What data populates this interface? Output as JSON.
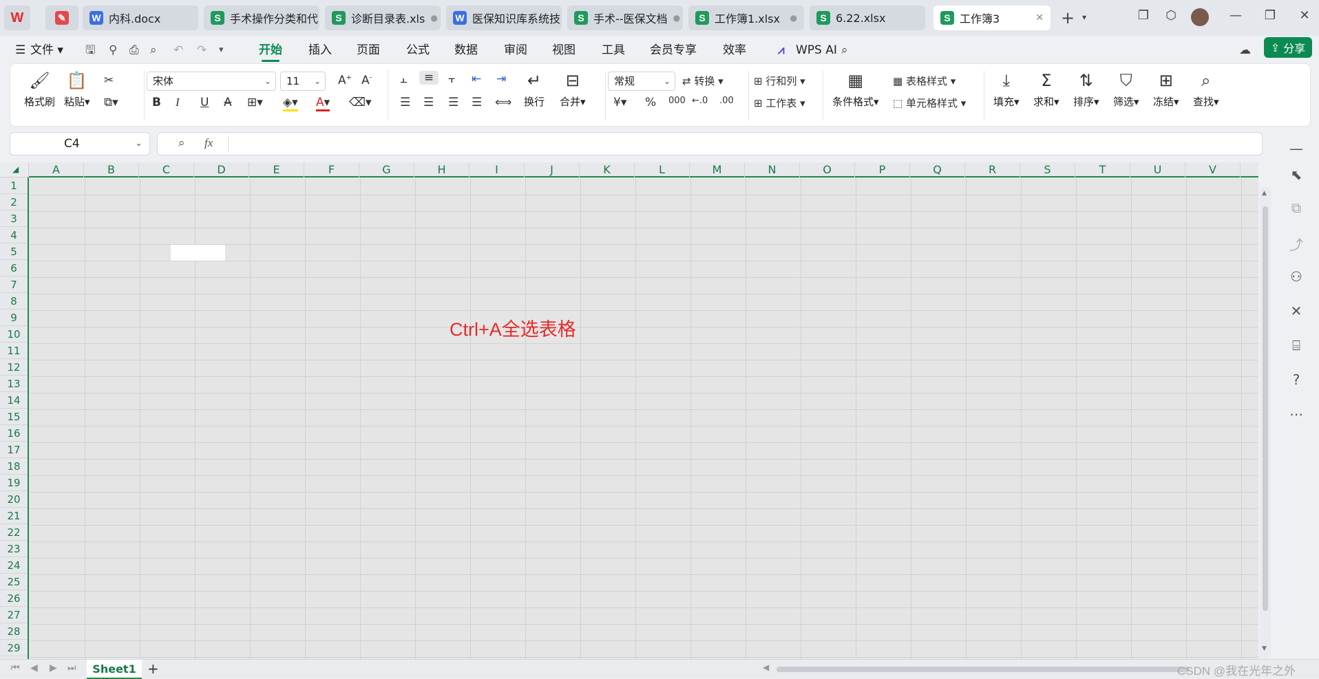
{
  "tabs": [
    {
      "label": "",
      "icon": "wps-logo-icon"
    },
    {
      "label": "",
      "icon": "pdf-icon"
    },
    {
      "label": "内科.docx",
      "type": "W"
    },
    {
      "label": "手术操作分类和代",
      "type": "S"
    },
    {
      "label": "诊断目录表.xls",
      "type": "S",
      "dot": "●"
    },
    {
      "label": "医保知识库系统技",
      "type": "W"
    },
    {
      "label": "手术--医保文档",
      "type": "S",
      "dot": "●"
    },
    {
      "label": "工作簿1.xlsx",
      "type": "S",
      "dot": "●"
    },
    {
      "label": "6.22.xlsx",
      "type": "S"
    },
    {
      "label": "工作簿3",
      "type": "S",
      "active": true,
      "close": "✕"
    }
  ],
  "menu": {
    "file": "文件",
    "items": [
      "开始",
      "插入",
      "页面",
      "公式",
      "数据",
      "审阅",
      "视图",
      "工具",
      "会员专享",
      "效率"
    ],
    "active": "开始",
    "wps_ai": "WPS AI",
    "share": "分享"
  },
  "ribbon": {
    "format_painter": "格式刷",
    "paste": "粘贴",
    "font_name": "宋体",
    "font_size": "11",
    "wrap": "换行",
    "merge": "合并",
    "number_format": "常规",
    "convert": "转换",
    "row_col": "行和列",
    "worksheet": "工作表",
    "table_style": "表格样式",
    "cond_format": "条件格式",
    "cell_style": "单元格样式",
    "fill": "填充",
    "sum": "求和",
    "sort": "排序",
    "filter": "筛选",
    "freeze": "冻结",
    "find": "查找"
  },
  "formula": {
    "namebox": "C4",
    "fx": "fx",
    "value": ""
  },
  "columns": [
    "A",
    "B",
    "C",
    "D",
    "E",
    "F",
    "G",
    "H",
    "I",
    "J",
    "K",
    "L",
    "M",
    "N",
    "O",
    "P",
    "Q",
    "R",
    "S",
    "T",
    "U",
    "V"
  ],
  "rows": [
    "1",
    "2",
    "3",
    "4",
    "5",
    "6",
    "7",
    "8",
    "9",
    "10",
    "11",
    "12",
    "13",
    "14",
    "15",
    "16",
    "17",
    "18",
    "19",
    "20",
    "21",
    "22",
    "23",
    "24",
    "25",
    "26",
    "27",
    "28",
    "29"
  ],
  "annotation": "Ctrl+A全选表格",
  "status": {
    "sheet": "Sheet1",
    "add": "+"
  },
  "watermark": "CSDN @我在光年之外",
  "colors": {
    "accent": "#0b8a52",
    "annotation": "#e52b2b",
    "selection_fill": "#e5e5e5"
  }
}
